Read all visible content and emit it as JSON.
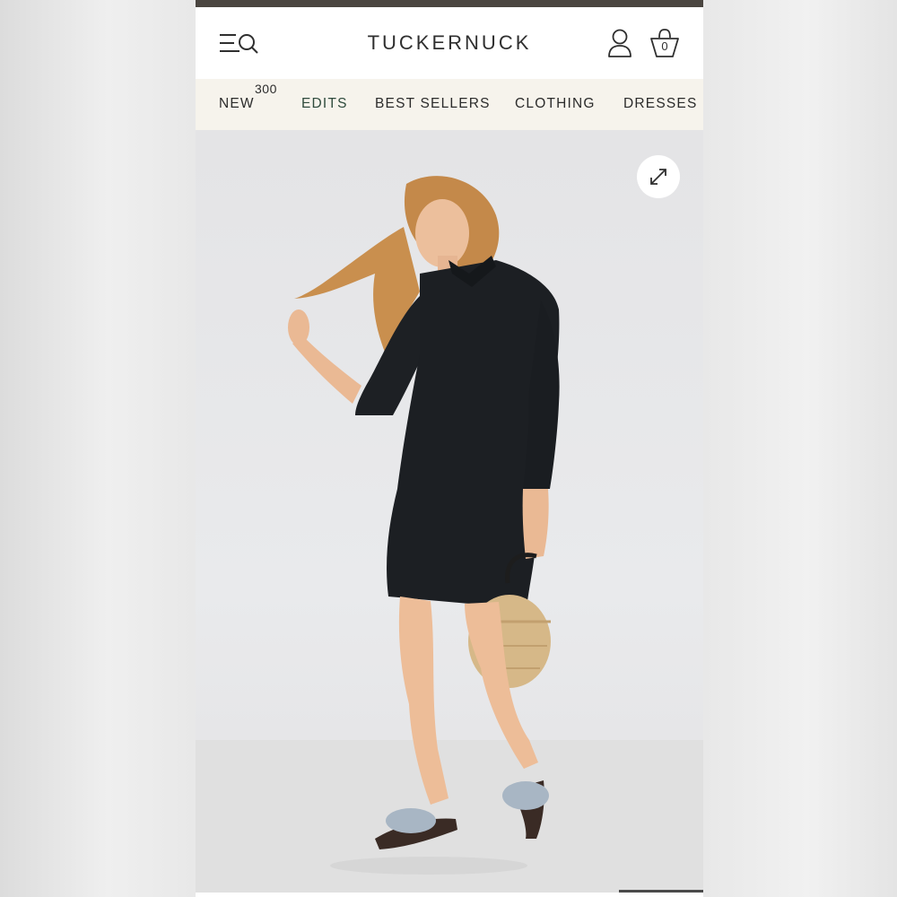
{
  "header": {
    "logo_text": "TUCKERNUCK",
    "bag_count": "0"
  },
  "nav": {
    "items": [
      {
        "label": "NEW",
        "badge": "300"
      },
      {
        "label": "EDITS",
        "active": true
      },
      {
        "label": "BEST SELLERS"
      },
      {
        "label": "CLOTHING"
      },
      {
        "label": "DRESSES"
      }
    ]
  },
  "hero": {
    "icons": [
      "expand-icon"
    ]
  },
  "colors": {
    "top_strip": "#4a4540",
    "nav_background": "#f6f3ec",
    "active_nav": "#2e4a3c",
    "text": "#2b2b2b"
  }
}
